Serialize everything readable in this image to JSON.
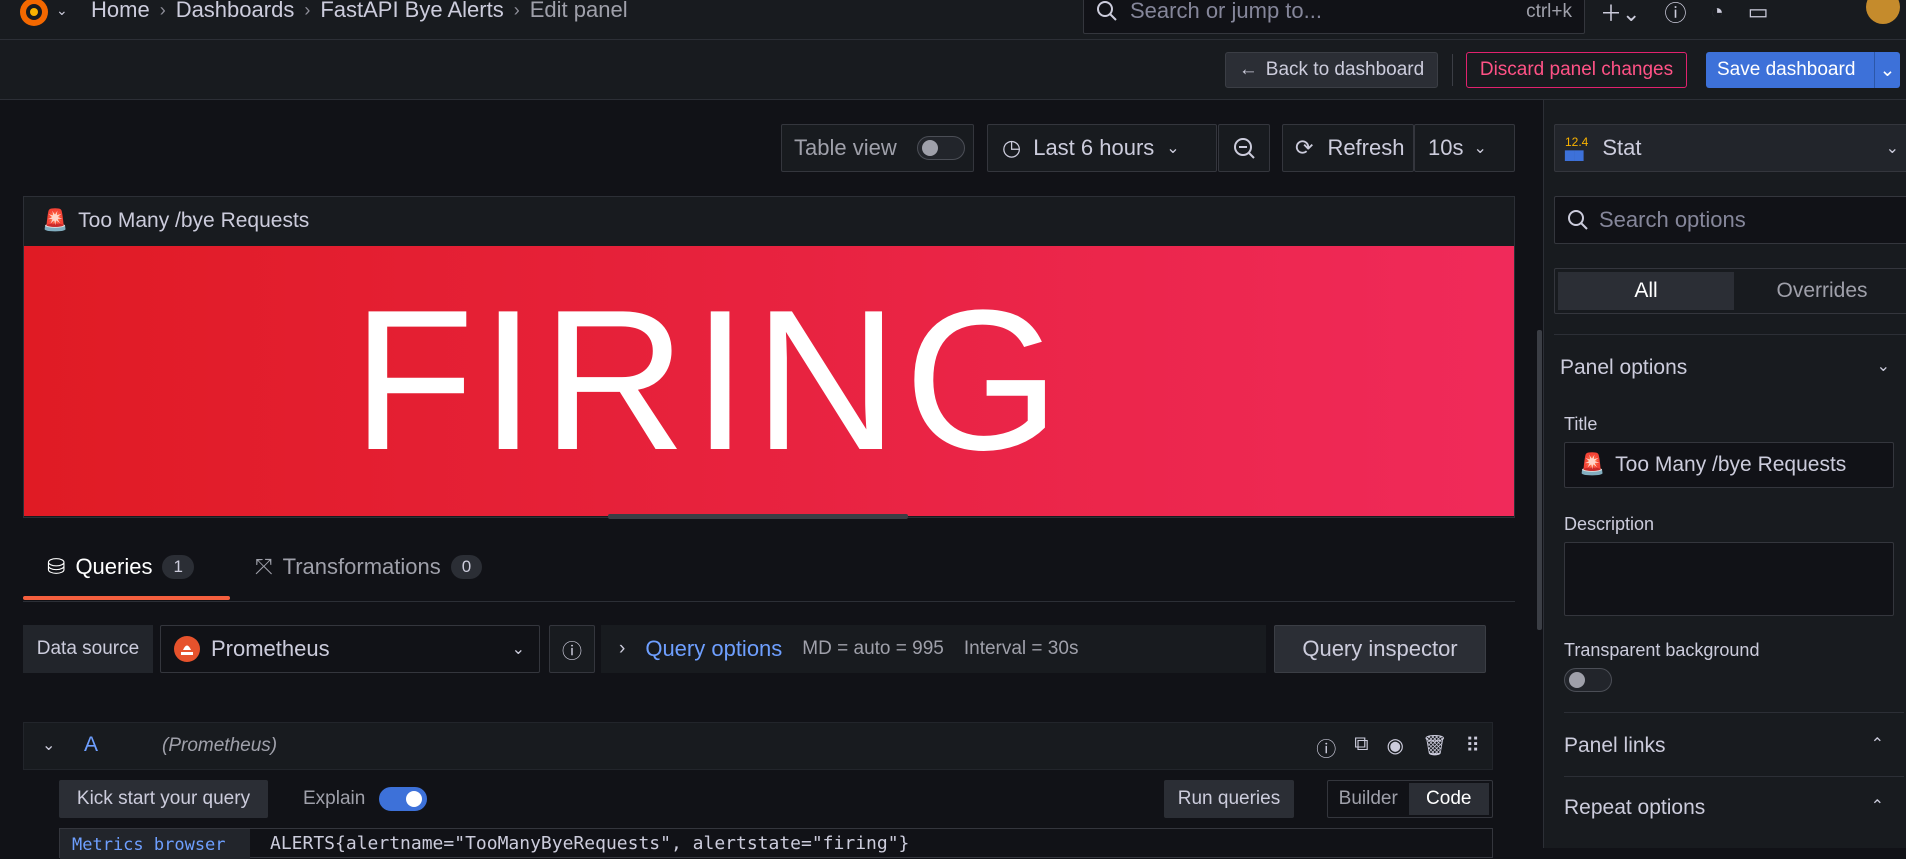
{
  "breadcrumbs": [
    "Home",
    "Dashboards",
    "FastAPI Bye Alerts",
    "Edit panel"
  ],
  "search": {
    "placeholder": "Search or jump to...",
    "shortcut": "ctrl+k"
  },
  "actions": {
    "back": "Back to dashboard",
    "discard": "Discard panel changes",
    "save": "Save dashboard"
  },
  "toolbar": {
    "table_view": "Table view",
    "time_range": "Last 6 hours",
    "refresh": "Refresh",
    "interval": "10s"
  },
  "panel": {
    "title": "Too Many /bye Requests",
    "value": "FIRING"
  },
  "tabs": [
    {
      "label": "Queries",
      "count": "1"
    },
    {
      "label": "Transformations",
      "count": "0"
    }
  ],
  "datasource": {
    "label": "Data source",
    "name": "Prometheus"
  },
  "query_options": {
    "label": "Query options",
    "md": "MD = auto = 995",
    "interval": "Interval = 30s",
    "inspector": "Query inspector"
  },
  "query": {
    "letter": "A",
    "datasource": "(Prometheus)",
    "kick": "Kick start your query",
    "explain": "Explain",
    "run": "Run queries",
    "modes": [
      "Builder",
      "Code"
    ],
    "metrics_label": "Metrics browser",
    "expr": "ALERTS{alertname=\"TooManyByeRequests\", alertstate=\"firing\"}"
  },
  "options": {
    "viz": "Stat",
    "viz_badge": "12.4",
    "search_placeholder": "Search options",
    "segments": [
      "All",
      "Overrides"
    ],
    "panel_options": "Panel options",
    "title_label": "Title",
    "title_value": "Too Many /bye Requests",
    "description_label": "Description",
    "transparent_label": "Transparent background",
    "panel_links": "Panel links",
    "repeat_options": "Repeat options"
  },
  "colors": {
    "firing_start": "#e01b24",
    "firing_end": "#f02a5a",
    "accent": "#3d71d9",
    "tab_underline": "#f55f3e"
  }
}
